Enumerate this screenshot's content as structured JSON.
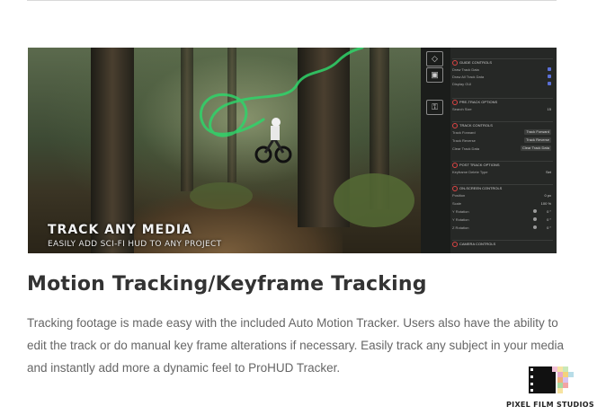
{
  "hero": {
    "overlay_title": "Track Any Media",
    "overlay_subtitle": "Easily add Sci-Fi HUD to any project",
    "panel": {
      "sections": [
        {
          "label": "GUIDE CONTROLS"
        },
        {
          "label": "PRE-TRACK OPTIONS"
        },
        {
          "label": "TRACK CONTROLS"
        },
        {
          "label": "POST TRACK OPTIONS"
        },
        {
          "label": "ON-SCREEN CONTROLS"
        },
        {
          "label": "CAMERA CONTROLS"
        }
      ],
      "rows": [
        {
          "label": "Draw Track Data"
        },
        {
          "label": "Draw All Track Data"
        },
        {
          "label": "Display GUI"
        },
        {
          "label": "Search Size",
          "value": "15"
        },
        {
          "label": "Track Forward",
          "button": "Track Forward"
        },
        {
          "label": "Track Reverse",
          "button": "Track Reverse"
        },
        {
          "label": "Clear Track Data",
          "button": "Clear Track Data"
        },
        {
          "label": "Keyframe Delete Type",
          "value": "Set"
        },
        {
          "label": "Position",
          "value": "0 px"
        },
        {
          "label": "Scale",
          "value": "100 %"
        },
        {
          "label": "Y Rotation",
          "value": "0 °"
        },
        {
          "label": "Y Rotation",
          "value": "0 °"
        },
        {
          "label": "Z Rotation",
          "value": "0 °"
        }
      ]
    }
  },
  "section": {
    "title": "Motion Tracking/Keyframe Tracking",
    "description": "Tracking footage is made easy with the included Auto Motion Tracker. Users also have the ability to edit the track or do manual key frame alterations if necessary. Easily track any subject in your media and instantly add more a dynamic feel to ProHUD Tracker."
  },
  "brand": {
    "name": "PIXEL FILM STUDIOS"
  },
  "colors": {
    "heading": "#333333",
    "body_text": "#666666",
    "track_line": "#2fd36a",
    "panel_bg": "#262826",
    "accent_red": "#dd4444",
    "accent_blue": "#5a6fd6"
  }
}
